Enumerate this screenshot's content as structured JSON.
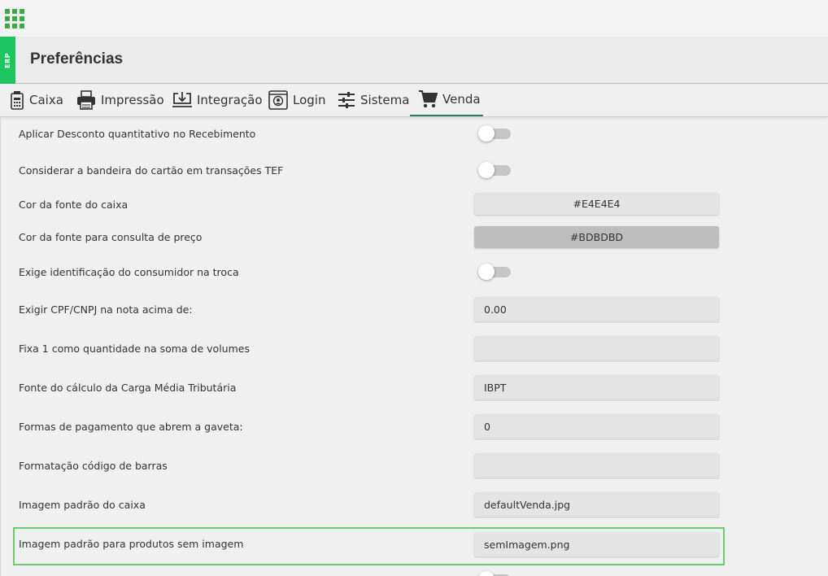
{
  "header": {
    "erp_tag": "ERP",
    "title": "Preferências"
  },
  "tabs": [
    {
      "label": "Caixa",
      "icon": "calculator-icon"
    },
    {
      "label": "Impressão",
      "icon": "printer-icon"
    },
    {
      "label": "Integração",
      "icon": "import-icon"
    },
    {
      "label": "Login",
      "icon": "login-icon"
    },
    {
      "label": "Sistema",
      "icon": "sliders-icon"
    },
    {
      "label": "Venda",
      "icon": "cart-icon",
      "active": true
    }
  ],
  "settings": [
    {
      "label": "Aplicar Desconto quantitativo no Recebimento",
      "type": "toggle",
      "value": false
    },
    {
      "label": "Considerar a bandeira do cartão em transações TEF",
      "type": "toggle",
      "value": false
    },
    {
      "label": "Cor da fonte do caixa",
      "type": "color",
      "value": "#E4E4E4"
    },
    {
      "label": "Cor da fonte para consulta de preço",
      "type": "color",
      "value": "#BDBDBD"
    },
    {
      "label": "Exige identificação do consumidor na troca",
      "type": "toggle",
      "value": false
    },
    {
      "label": "Exigir CPF/CNPJ na nota acima de:",
      "type": "text",
      "value": "0.00"
    },
    {
      "label": "Fixa 1 como quantidade na soma de volumes",
      "type": "text",
      "value": ""
    },
    {
      "label": "Fonte do cálculo da Carga Média Tributária",
      "type": "text",
      "value": "IBPT"
    },
    {
      "label": "Formas de pagamento que abrem a gaveta:",
      "type": "text",
      "value": "0"
    },
    {
      "label": "Formatação código de barras",
      "type": "text",
      "value": ""
    },
    {
      "label": "Imagem padrão do caixa",
      "type": "text",
      "value": "defaultVenda.jpg"
    },
    {
      "label": "Imagem padrão para produtos sem imagem",
      "type": "text",
      "value": "semImagem.png",
      "highlighted": true
    }
  ],
  "colors": {
    "accent": "#1cc55e",
    "tab_underline": "#2a7a58",
    "highlight": "#6ccb72",
    "apps_icon": "#3daa4a"
  }
}
